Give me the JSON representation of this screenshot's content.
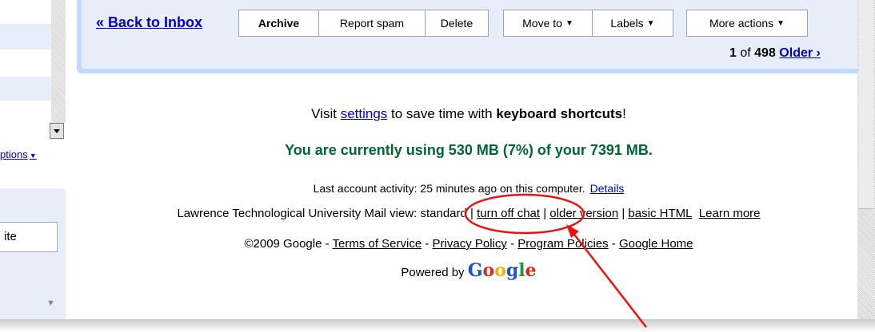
{
  "toolbar": {
    "back_label": "« Back to Inbox",
    "archive_label": "Archive",
    "spam_label": "Report spam",
    "delete_label": "Delete",
    "move_label": "Move to",
    "labels_label": "Labels",
    "more_label": "More actions",
    "caret": "▼"
  },
  "pager": {
    "current": "1",
    "of_text": " of ",
    "total": "498",
    "older_label": "Older ›"
  },
  "sidebar": {
    "options_label": "ptions",
    "input_value": "ite",
    "down_arrow": "▼"
  },
  "footer": {
    "shortcuts_pre": "Visit ",
    "settings_link": "settings",
    "shortcuts_mid": " to save time with ",
    "shortcuts_bold": "keyboard shortcuts",
    "shortcuts_post": "!",
    "quota_text": "You are currently using 530 MB (7%) of your 7391 MB.",
    "activity_text": "Last account activity: 25 minutes ago on this computer.",
    "details_link": "Details",
    "views_prefix": "Lawrence Technological University Mail view: standard | ",
    "turn_off_chat": "turn off chat",
    "sep": " | ",
    "older_version": "older version",
    "basic_html": "basic HTML",
    "learn_more": "Learn more",
    "copyright": "©2009 Google - ",
    "terms": "Terms of Service",
    "dash": " - ",
    "privacy": "Privacy Policy",
    "program": "Program Policies",
    "google_home": "Google Home",
    "powered_by": "Powered by ",
    "logo_g1": "G",
    "logo_g2": "o",
    "logo_g3": "o",
    "logo_g4": "g",
    "logo_g5": "l",
    "logo_g6": "e"
  },
  "colors": {
    "annotation": "#ee1111",
    "quota_green": "#006633",
    "link_blue": "#0000cc",
    "toolbar_blue": "#c3d9ff"
  }
}
